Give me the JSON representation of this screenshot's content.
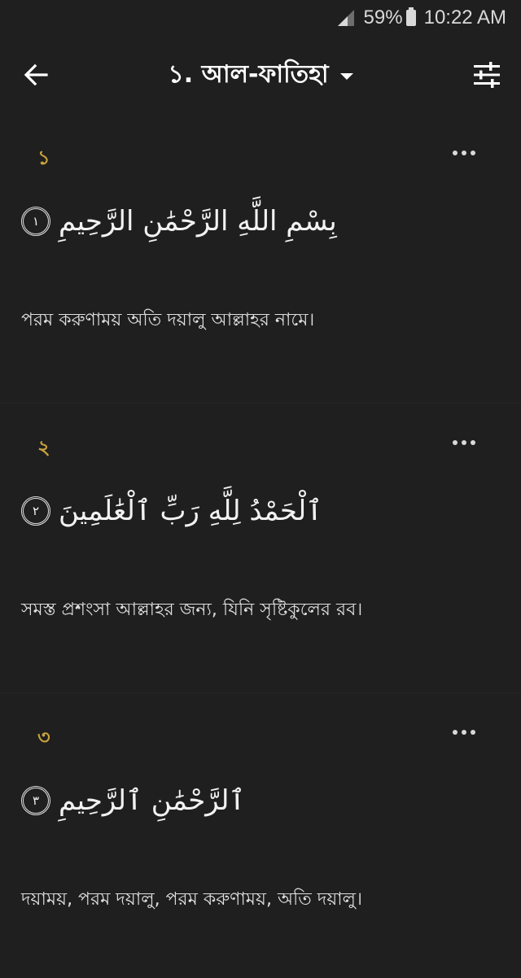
{
  "status": {
    "battery": "59%",
    "time": "10:22 AM"
  },
  "header": {
    "title": "১. আল-ফাতিহা"
  },
  "verses": [
    {
      "number": "১",
      "arabic": "بِسْمِ اللَّهِ الرَّحْمَٰنِ الرَّحِيمِ",
      "ayah_marker": "١",
      "translation": "পরম করুণাময় অতি দয়ালু আল্লাহর নামে।"
    },
    {
      "number": "২",
      "arabic": "ٱلْحَمْدُ لِلَّهِ رَبِّ ٱلْعَٰلَمِينَ",
      "ayah_marker": "٢",
      "translation": "সমস্ত প্রশংসা আল্লাহর জন্য, যিনি সৃষ্টিকুলের রব।"
    },
    {
      "number": "৩",
      "arabic": "ٱلرَّحْمَٰنِ ٱلرَّحِيمِ",
      "ayah_marker": "٣",
      "translation": "দয়াময়, পরম দয়ালু, পরম করুণাময়, অতি দয়ালু।"
    }
  ],
  "colors": {
    "background": "#1f1f1f",
    "verse_number": "#c9a33c",
    "text": "#e8e8e8"
  },
  "icons": {
    "back": "arrow-left-icon",
    "settings": "tune-sliders-icon",
    "menu": "more-horizontal-icon",
    "dropdown": "chevron-down-icon",
    "signal": "signal-icon",
    "battery": "battery-icon"
  }
}
